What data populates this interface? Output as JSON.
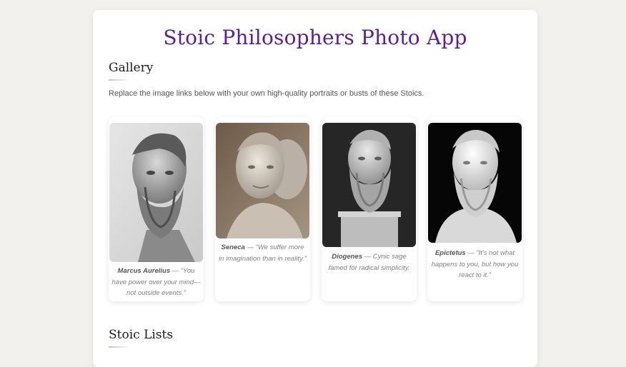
{
  "app": {
    "title": "Stoic Philosophers Photo App"
  },
  "gallery": {
    "heading": "Gallery",
    "intro": "Replace the image links below with your own high-quality portraits or busts of these Stoics.",
    "items": [
      {
        "name": "Marcus Aurelius",
        "quote": "— “You have power over your mind—not outside events.”"
      },
      {
        "name": "Seneca",
        "quote": "— “We suffer more in imagination than in reality.”"
      },
      {
        "name": "Diogenes",
        "quote": "— Cynic sage famed for radical simplicity."
      },
      {
        "name": "Epictetus",
        "quote": "— “It's not what happens to you, but how you react to it.”"
      }
    ]
  },
  "lists": {
    "heading": "Stoic Lists"
  },
  "colors": {
    "accent": "#5b1d99",
    "page_bg": "#f3f1ee",
    "card_bg": "#ffffff"
  }
}
